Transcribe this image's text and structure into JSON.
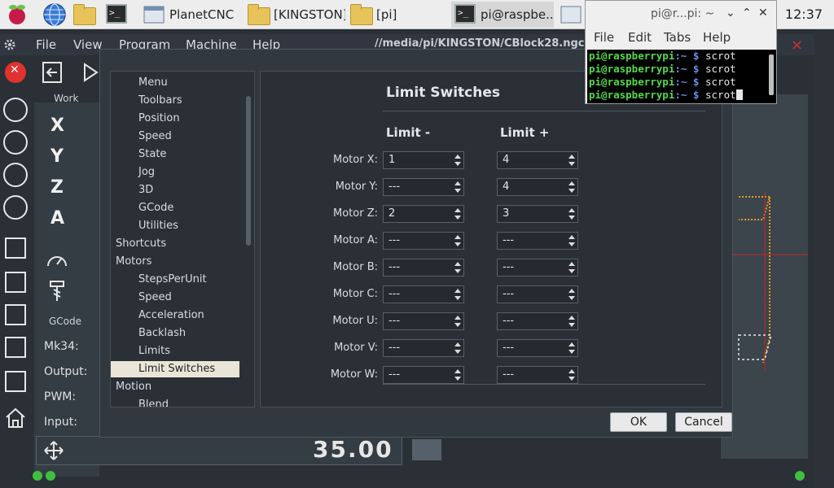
{
  "taskbar": {
    "windows": [
      {
        "label": "PlanetCNC",
        "icon": "app-icon"
      },
      {
        "label": "[KINGSTON]",
        "icon": "folder-icon"
      },
      {
        "label": "[pi]",
        "icon": "folder-icon"
      },
      {
        "label": "pi@raspbe...",
        "icon": "terminal-icon"
      }
    ],
    "clock": "12:37"
  },
  "app": {
    "menu": [
      "File",
      "View",
      "Program",
      "Machine",
      "Help"
    ],
    "file_path": "//media/pi/KINGSTON/CBlock28.ngc",
    "tabs": {
      "work": "Work",
      "gcode": "GCode"
    },
    "axes": [
      "X",
      "Y",
      "Z",
      "A"
    ],
    "gcode_rows": [
      "Mk34:",
      "Output:",
      "PWM:",
      "Input:"
    ],
    "bottom_value": "35.00"
  },
  "dialog": {
    "tree": [
      {
        "label": "Menu",
        "indent": 1
      },
      {
        "label": "Toolbars",
        "indent": 1
      },
      {
        "label": "Position",
        "indent": 1
      },
      {
        "label": "Speed",
        "indent": 1
      },
      {
        "label": "State",
        "indent": 1
      },
      {
        "label": "Jog",
        "indent": 1
      },
      {
        "label": "3D",
        "indent": 1
      },
      {
        "label": "GCode",
        "indent": 1
      },
      {
        "label": "Utilities",
        "indent": 1
      },
      {
        "label": "Shortcuts",
        "indent": 0
      },
      {
        "label": "Motors",
        "indent": 0
      },
      {
        "label": "StepsPerUnit",
        "indent": 1
      },
      {
        "label": "Speed",
        "indent": 1
      },
      {
        "label": "Acceleration",
        "indent": 1
      },
      {
        "label": "Backlash",
        "indent": 1
      },
      {
        "label": "Limits",
        "indent": 1
      },
      {
        "label": "Limit Switches",
        "indent": 1,
        "selected": true
      },
      {
        "label": "Motion",
        "indent": 0
      },
      {
        "label": "Blend",
        "indent": 1
      }
    ],
    "title": "Limit Switches",
    "col_minus": "Limit -",
    "col_plus": "Limit +",
    "motors": [
      {
        "label": "Motor X:",
        "minus": "1",
        "plus": "4"
      },
      {
        "label": "Motor Y:",
        "minus": "---",
        "plus": "4"
      },
      {
        "label": "Motor Z:",
        "minus": "2",
        "plus": "3"
      },
      {
        "label": "Motor A:",
        "minus": "---",
        "plus": "---"
      },
      {
        "label": "Motor B:",
        "minus": "---",
        "plus": "---"
      },
      {
        "label": "Motor C:",
        "minus": "---",
        "plus": "---"
      },
      {
        "label": "Motor U:",
        "minus": "---",
        "plus": "---"
      },
      {
        "label": "Motor V:",
        "minus": "---",
        "plus": "---"
      },
      {
        "label": "Motor W:",
        "minus": "---",
        "plus": "---"
      }
    ],
    "ok": "OK",
    "cancel": "Cancel"
  },
  "terminal": {
    "title": "pi@r...pi: ~",
    "menu": [
      "File",
      "Edit",
      "Tabs",
      "Help"
    ],
    "lines": [
      {
        "user": "pi@raspberrypi",
        "cwd": ":~ $",
        "cmd": "scrot"
      },
      {
        "user": "pi@raspberrypi",
        "cwd": ":~ $",
        "cmd": "scrot"
      },
      {
        "user": "pi@raspberrypi",
        "cwd": ":~ $",
        "cmd": "scrot"
      },
      {
        "user": "pi@raspberrypi",
        "cwd": ":~ $",
        "cmd": "scrot"
      }
    ]
  }
}
